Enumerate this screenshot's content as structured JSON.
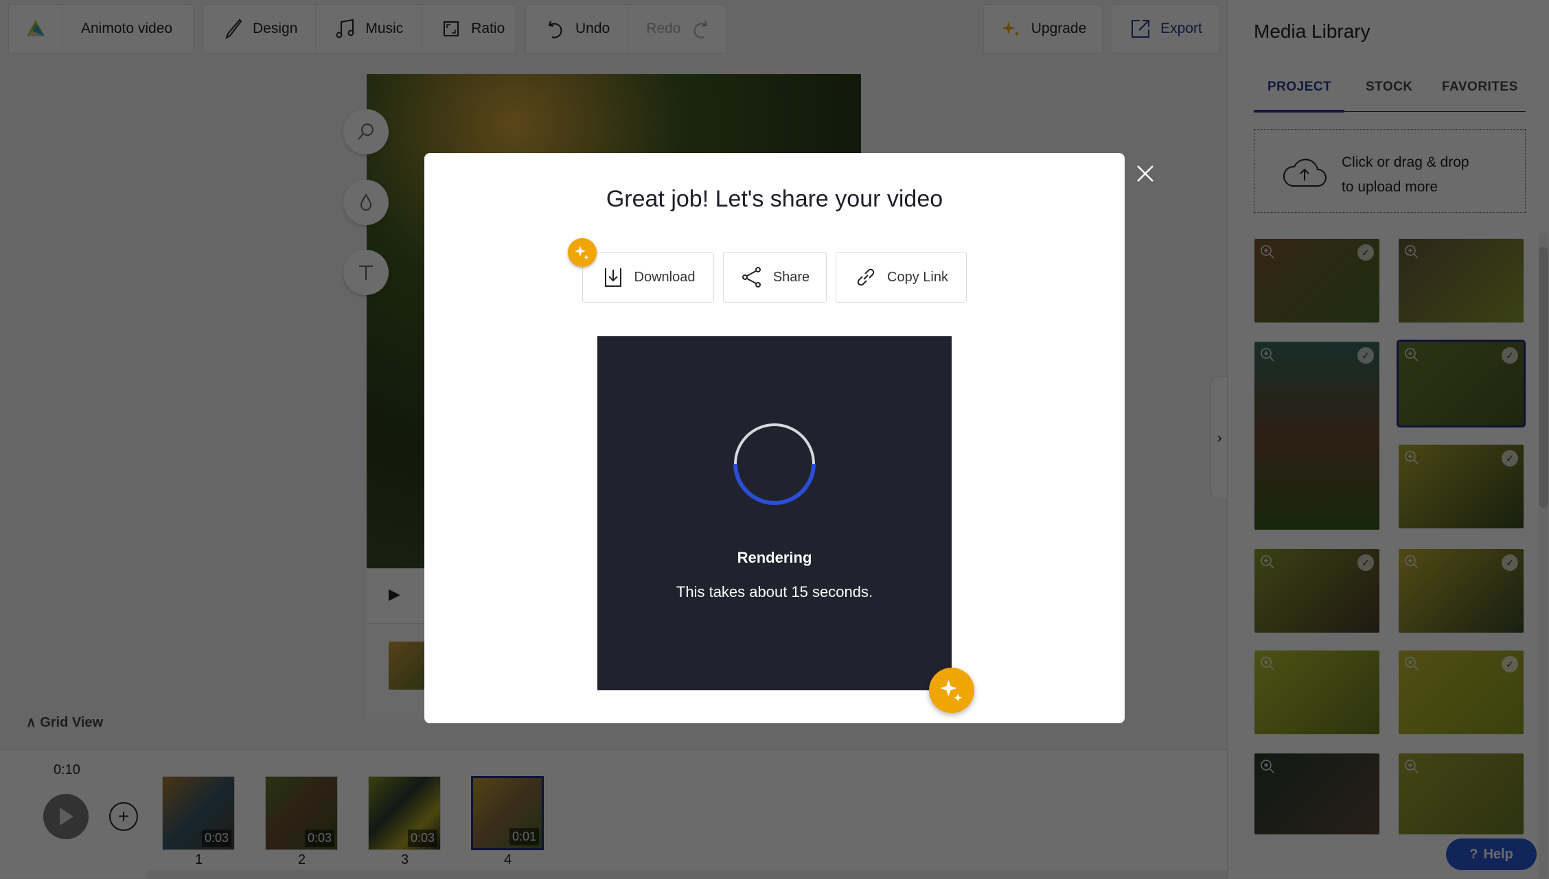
{
  "toolbar": {
    "project_name": "Animoto video",
    "design": "Design",
    "music": "Music",
    "ratio": "Ratio",
    "undo": "Undo",
    "redo": "Redo",
    "upgrade": "Upgrade",
    "export": "Export"
  },
  "editor": {
    "grid_view": "Grid View",
    "total_time": "0:10",
    "blocks": [
      {
        "number": "1",
        "duration": "0:03"
      },
      {
        "number": "2",
        "duration": "0:03"
      },
      {
        "number": "3",
        "duration": "0:03"
      },
      {
        "number": "4",
        "duration": "0:01",
        "selected": true
      }
    ]
  },
  "media_library": {
    "title": "Media Library",
    "tabs": [
      "PROJECT",
      "STOCK",
      "FAVORITES"
    ],
    "active_tab": "PROJECT",
    "upload_line1": "Click or drag & drop",
    "upload_line2": "to upload more",
    "items": [
      {
        "checked": true
      },
      {
        "checked": false
      },
      {
        "checked": true,
        "tall": true
      },
      {
        "checked": true,
        "selected": true
      },
      {
        "checked": true
      },
      {
        "checked": true
      },
      {
        "checked": true
      },
      {
        "checked": false
      },
      {
        "checked": true
      },
      {
        "checked": false
      },
      {
        "checked": false
      }
    ],
    "help": "Help"
  },
  "modal": {
    "title": "Great job! Let's share your video",
    "download": "Download",
    "share": "Share",
    "copy_link": "Copy Link",
    "status": "Rendering",
    "status_detail": "This takes about 15 seconds."
  },
  "colors": {
    "accent": "#2a3a8f",
    "sparkle": "#f0a500",
    "render_bg": "#20222e",
    "spinner": "#2a4fd6",
    "help": "#2a57d6"
  }
}
